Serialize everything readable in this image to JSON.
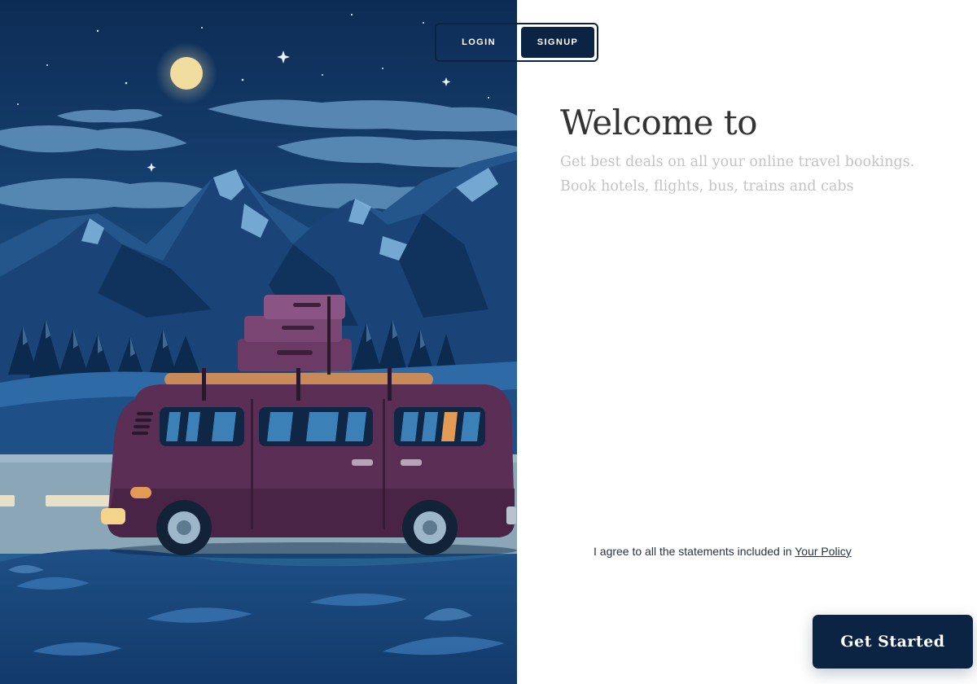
{
  "auth": {
    "login_label": "LOGIN",
    "signup_label": "SIGNUP",
    "active_tab": "SIGNUP"
  },
  "main": {
    "title": "Welcome to",
    "subtitle": "Get best deals on all your online travel bookings. Book hotels, flights, bus, trains and cabs",
    "policy_text": "I agree to all the statements included in",
    "policy_link": "Your Policy",
    "cta_label": "Get Started"
  },
  "colors": {
    "brand_navy": "#0b2444",
    "sky": "#0f3a66",
    "van": "#5a2e55",
    "moon": "#f1dda0",
    "title_text": "#333333",
    "subtitle_text": "#c4c4c4"
  },
  "illustration": {
    "subject": "camper van with luggage on roof, night mountain landscape"
  }
}
